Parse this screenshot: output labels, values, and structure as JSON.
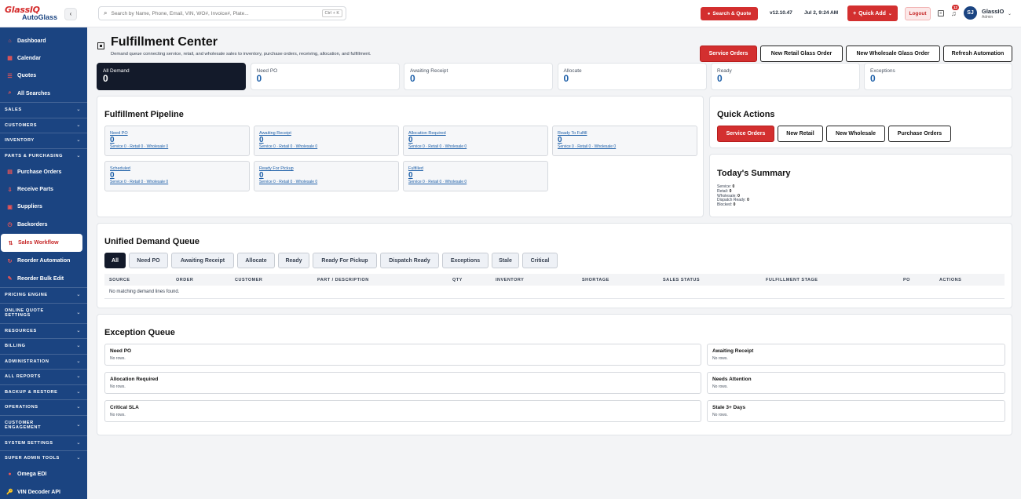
{
  "brand": {
    "logo_top": "GlassIQ",
    "logo_bottom": "AutoGlass",
    "collapse_glyph": "‹"
  },
  "sidebar": {
    "items": [
      {
        "type": "link",
        "label": "Dashboard",
        "icon": "⌂"
      },
      {
        "type": "link",
        "label": "Calendar",
        "icon": "▦"
      },
      {
        "type": "link",
        "label": "Quotes",
        "icon": "☰"
      },
      {
        "type": "link",
        "label": "All Searches",
        "icon": "⌕"
      },
      {
        "type": "section",
        "label": "SALES"
      },
      {
        "type": "section",
        "label": "CUSTOMERS"
      },
      {
        "type": "section",
        "label": "INVENTORY"
      },
      {
        "type": "section",
        "label": "PARTS & PURCHASING"
      },
      {
        "type": "link",
        "label": "Purchase Orders",
        "icon": "▤"
      },
      {
        "type": "link",
        "label": "Receive Parts",
        "icon": "⇩"
      },
      {
        "type": "link",
        "label": "Suppliers",
        "icon": "▣"
      },
      {
        "type": "link",
        "label": "Backorders",
        "icon": "◷"
      },
      {
        "type": "link",
        "label": "Sales Workflow",
        "icon": "⇅",
        "active": true
      },
      {
        "type": "link",
        "label": "Reorder Automation",
        "icon": "↻"
      },
      {
        "type": "link",
        "label": "Reorder Bulk Edit",
        "icon": "✎"
      },
      {
        "type": "section",
        "label": "PRICING ENGINE"
      },
      {
        "type": "section",
        "label": "ONLINE QUOTE SETTINGS",
        "two": true
      },
      {
        "type": "section",
        "label": "RESOURCES"
      },
      {
        "type": "section",
        "label": "BILLING"
      },
      {
        "type": "section",
        "label": "ADMINISTRATION"
      },
      {
        "type": "section",
        "label": "ALL REPORTS"
      },
      {
        "type": "section",
        "label": "BACKUP & RESTORE"
      },
      {
        "type": "section",
        "label": "OPERATIONS"
      },
      {
        "type": "section",
        "label": "CUSTOMER ENGAGEMENT",
        "two": true
      },
      {
        "type": "section",
        "label": "SYSTEM SETTINGS"
      },
      {
        "type": "section",
        "label": "SUPER ADMIN TOOLS"
      },
      {
        "type": "link",
        "label": "Omega EDI",
        "icon": "●"
      },
      {
        "type": "link",
        "label": "VIN Decoder API",
        "icon": "🔑"
      }
    ]
  },
  "topbar": {
    "search_placeholder": "Search by Name, Phone, Email, VIN, WO#, Invoice#, Plate...",
    "search_shortcut": "Ctrl + K",
    "search_quote_label": "Search & Quote",
    "version": "v12.10.47",
    "datetime": "Jul 2, 9:24 AM",
    "quick_add_label": "Quick Add",
    "logout_label": "Logout",
    "notif_count": "12",
    "user_initials": "SJ",
    "user_name": "GlassIO",
    "user_role": "Admin"
  },
  "header": {
    "title": "Fulfillment Center",
    "subtitle": "Demand queue connecting service, retail, and wholesale sales to inventory, purchase orders, receiving, allocation, and fulfillment.",
    "buttons": [
      "Service Orders",
      "New Retail Glass Order",
      "New Wholesale Glass Order",
      "Refresh Automation"
    ]
  },
  "stats": [
    {
      "label": "All Demand",
      "value": "0",
      "active": true
    },
    {
      "label": "Need PO",
      "value": "0"
    },
    {
      "label": "Awaiting Receipt",
      "value": "0"
    },
    {
      "label": "Allocate",
      "value": "0"
    },
    {
      "label": "Ready",
      "value": "0"
    },
    {
      "label": "Exceptions",
      "value": "0"
    }
  ],
  "pipeline": {
    "title": "Fulfillment Pipeline",
    "cards": [
      {
        "label": "Need PO",
        "value": "0",
        "sub": "Service 0 · Retail 0 · Wholesale 0"
      },
      {
        "label": "Awaiting Receipt",
        "value": "0",
        "sub": "Service 0 · Retail 0 · Wholesale 0"
      },
      {
        "label": "Allocation Required",
        "value": "0",
        "sub": "Service 0 · Retail 0 · Wholesale 0"
      },
      {
        "label": "Ready To Fulfill",
        "value": "0",
        "sub": "Service 0 · Retail 0 · Wholesale 0"
      },
      {
        "label": "Scheduled",
        "value": "0",
        "sub": "Service 0 · Retail 0 · Wholesale 0"
      },
      {
        "label": "Ready For Pickup",
        "value": "0",
        "sub": "Service 0 · Retail 0 · Wholesale 0"
      },
      {
        "label": "Fulfilled",
        "value": "0",
        "sub": "Service 0 · Retail 0 · Wholesale 0"
      }
    ]
  },
  "quick_actions": {
    "title": "Quick Actions",
    "buttons": [
      "Service Orders",
      "New Retail",
      "New Wholesale",
      "Purchase Orders"
    ]
  },
  "summary": {
    "title": "Today's Summary",
    "lines": [
      {
        "label": "Service:",
        "value": "0"
      },
      {
        "label": "Retail:",
        "value": "0"
      },
      {
        "label": "Wholesale:",
        "value": "0"
      },
      {
        "label": "Dispatch Ready:",
        "value": "0"
      },
      {
        "label": "Blocked:",
        "value": "0"
      }
    ]
  },
  "queue": {
    "title": "Unified Demand Queue",
    "filters": [
      "All",
      "Need PO",
      "Awaiting Receipt",
      "Allocate",
      "Ready",
      "Ready For Pickup",
      "Dispatch Ready",
      "Exceptions",
      "Stale",
      "Critical"
    ],
    "columns": [
      "SOURCE",
      "ORDER",
      "CUSTOMER",
      "PART / DESCRIPTION",
      "QTY",
      "INVENTORY",
      "SHORTAGE",
      "SALES STATUS",
      "FULFILLMENT STAGE",
      "PO",
      "ACTIONS"
    ],
    "empty": "No matching demand lines found."
  },
  "exceptions": {
    "title": "Exception Queue",
    "items": [
      {
        "title": "Need PO",
        "sub": "No rows."
      },
      {
        "title": "Awaiting Receipt",
        "sub": "No rows."
      },
      {
        "title": "Allocation Required",
        "sub": "No rows."
      },
      {
        "title": "Needs Attention",
        "sub": "No rows."
      },
      {
        "title": "Critical SLA",
        "sub": "No rows."
      },
      {
        "title": "Stale 3+ Days",
        "sub": "No rows."
      }
    ]
  }
}
